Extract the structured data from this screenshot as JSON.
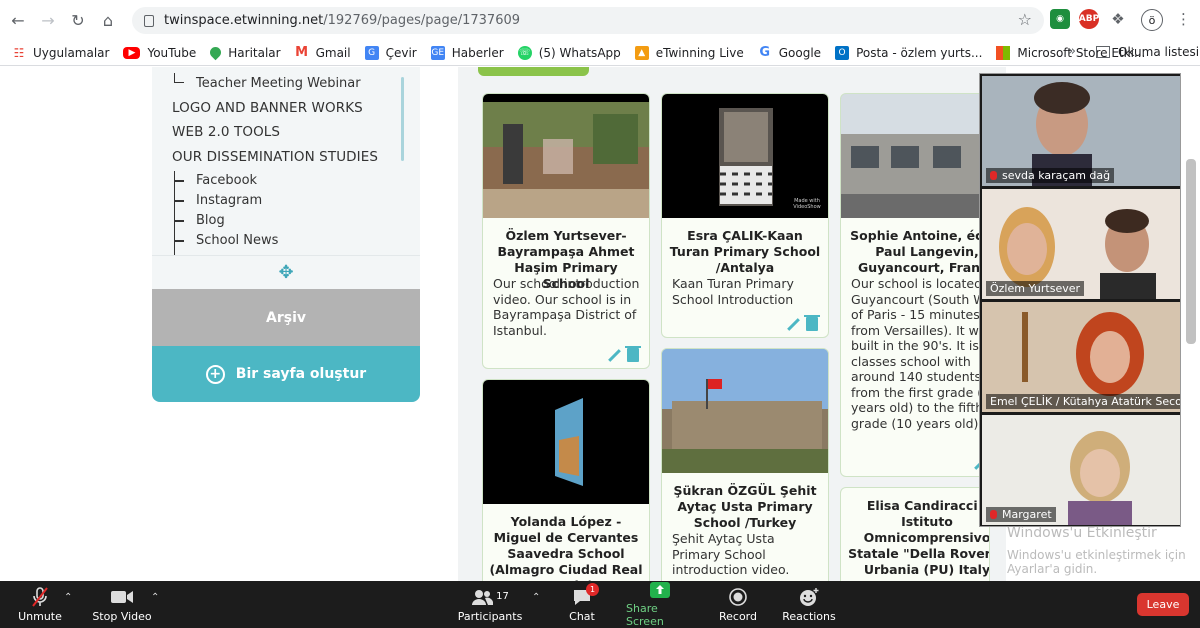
{
  "browser": {
    "url_host": "twinspace.etwinning.net",
    "url_path": "/192769/pages/page/1737609",
    "extensions": [
      "ABP"
    ],
    "profile_initial": "ö"
  },
  "bookmarks": {
    "items": [
      {
        "label": "Uygulamalar",
        "icon": "apps-grid-icon",
        "color": "#e94235"
      },
      {
        "label": "YouTube",
        "icon": "youtube-icon",
        "color": "#ff0000"
      },
      {
        "label": "Haritalar",
        "icon": "maps-pin-icon",
        "color": "#34a853"
      },
      {
        "label": "Gmail",
        "icon": "gmail-icon",
        "color": "#ea4335"
      },
      {
        "label": "Çevir",
        "icon": "translate-icon",
        "color": "#4285f4"
      },
      {
        "label": "Haberler",
        "icon": "news-icon",
        "color": "#4285f4"
      },
      {
        "label": "(5) WhatsApp",
        "icon": "whatsapp-icon",
        "color": "#25d366"
      },
      {
        "label": "eTwinning Live",
        "icon": "etwinning-icon",
        "color": "#f39c12"
      },
      {
        "label": "Google",
        "icon": "google-icon",
        "color": "#4285f4"
      },
      {
        "label": "Posta - özlem yurts...",
        "icon": "outlook-icon",
        "color": "#0072c6"
      },
      {
        "label": "Microsoft Store Etki...",
        "icon": "microsoft-icon",
        "color": "#f25022"
      }
    ],
    "more": "»",
    "reading_list": "Okuma listesi"
  },
  "sidebar": {
    "items": [
      {
        "label": "Teacher Meeting Webinar",
        "level": "sub"
      },
      {
        "label": "LOGO AND BANNER WORKS",
        "level": "top"
      },
      {
        "label": "WEB 2.0 TOOLS",
        "level": "top"
      },
      {
        "label": "OUR DISSEMINATION STUDIES",
        "level": "top"
      },
      {
        "label": "Facebook",
        "level": "sub"
      },
      {
        "label": "Instagram",
        "level": "sub"
      },
      {
        "label": "Blog",
        "level": "sub"
      },
      {
        "label": "School News",
        "level": "sub"
      }
    ],
    "archive_label": "Arşiv",
    "create_label": "Bir sayfa oluştur"
  },
  "cards": [
    {
      "title": "Özlem Yurtsever- Bayrampaşa Ahmet Haşim Primary School",
      "desc": "Our school introduction video. Our school is in Bayrampaşa District of Istanbul.",
      "thumb_caption": ""
    },
    {
      "title": "Esra ÇALIK-Kaan Turan Primary School /Antalya",
      "desc": "Kaan Turan Primary School Introduction",
      "thumb_caption": "Made with VideoShow"
    },
    {
      "title": "Sophie Antoine, école Paul Langevin, Guyancourt, France",
      "desc": "Our school is located in Guyancourt (South West of Paris - 15 minutes from Versailles). It was built in the 90's. It is a 6 classes school with around 140 students from the first grade (6 years old) to the fifth grade (10 years old).",
      "thumb_caption": ""
    },
    {
      "title": "Yolanda López - Miguel de Cervantes Saavedra School (Almagro Ciudad Real - Spain)",
      "desc": "",
      "thumb_caption": ""
    },
    {
      "title": "Şükran ÖZGÜL Şehit Aytaç Usta Primary School /Turkey",
      "desc": "Şehit Aytaç Usta Primary School introduction video.",
      "thumb_caption": ""
    },
    {
      "title": "Elisa Candiracci - Istituto Omnicomprensivo Statale \"Della Rovere\" Urbania (PU) Italy",
      "desc": "",
      "thumb_caption": ""
    }
  ],
  "windows_activation": {
    "line1": "Windows'u Etkinleştir",
    "line2": "Windows'u etkinleştirmek için Ayarlar'a gidin."
  },
  "participants_video": [
    {
      "name": "sevda karaçam dağ",
      "muted": true
    },
    {
      "name": "Özlem Yurtsever",
      "muted": false
    },
    {
      "name": "Emel ÇELİK / Kütahya Atatürk Secon...",
      "muted": false
    },
    {
      "name": "Margaret",
      "muted": true
    }
  ],
  "zoom_toolbar": {
    "unmute": "Unmute",
    "stop_video": "Stop Video",
    "participants": "Participants",
    "participant_count": "17",
    "chat": "Chat",
    "chat_badge": "1",
    "share_screen": "Share Screen",
    "record": "Record",
    "reactions": "Reactions",
    "leave": "Leave"
  },
  "colors": {
    "accent_teal": "#4cb7c4",
    "archive_gray": "#b3b3b3",
    "green_bar": "#8bc34a",
    "share_green": "#22b14c",
    "leave_red": "#d9362f"
  }
}
